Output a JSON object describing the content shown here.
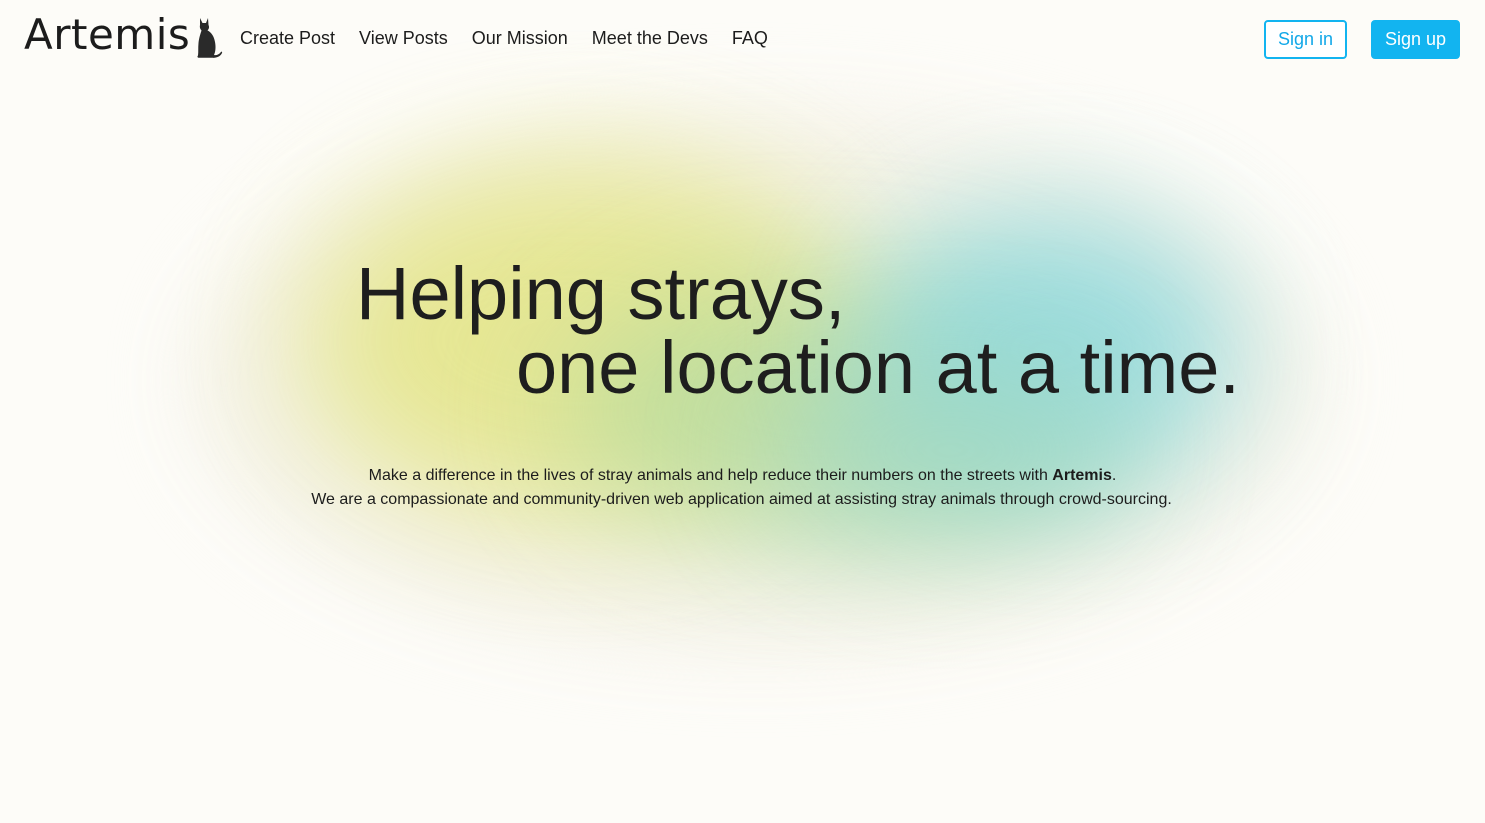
{
  "header": {
    "logo_text": "Artemis",
    "logo_icon": "cat-silhouette-icon",
    "nav": [
      {
        "label": "Create Post"
      },
      {
        "label": "View Posts"
      },
      {
        "label": "Our Mission"
      },
      {
        "label": "Meet the Devs"
      },
      {
        "label": "FAQ"
      }
    ],
    "sign_in_label": "Sign in",
    "sign_up_label": "Sign up"
  },
  "hero": {
    "headline_line1": "Helping strays,",
    "headline_line2": "one location at a time.",
    "desc_line1_prefix": "Make a difference in the lives of stray animals and help reduce their numbers on the streets with ",
    "desc_line1_brand": "Artemis",
    "desc_line1_suffix": ".",
    "desc_line2": "We are a compassionate and community-driven web application aimed at assisting stray animals through crowd-sourcing."
  },
  "colors": {
    "accent": "#12b4f0",
    "background": "#fdfcf8",
    "text": "#1c1c1c",
    "blob_yellow": "#e4e585",
    "blob_green": "#b9dca0",
    "blob_teal": "#8fd9de"
  }
}
